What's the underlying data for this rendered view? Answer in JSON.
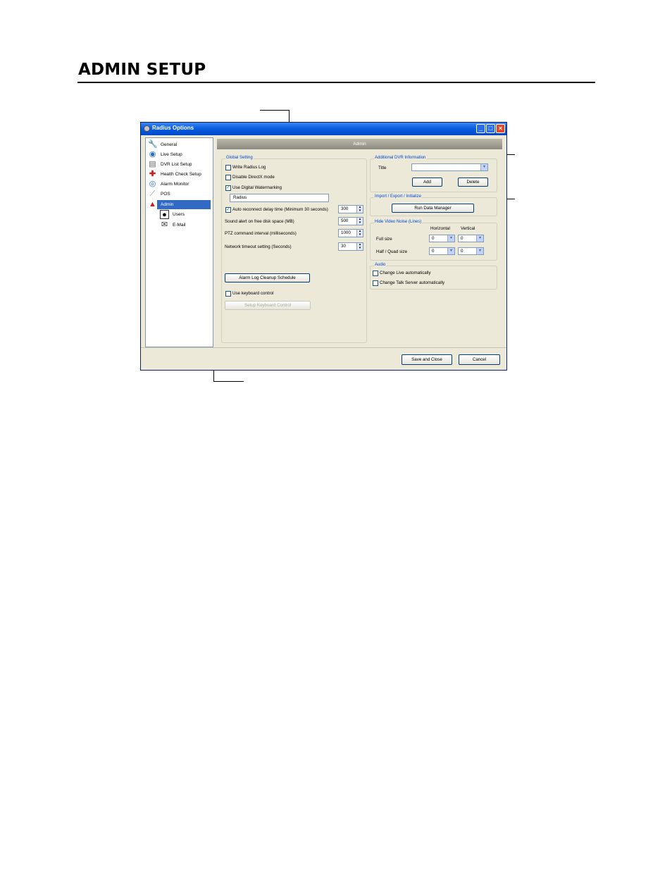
{
  "document": {
    "title": "ADMIN SETUP"
  },
  "window": {
    "title": "Radius Options"
  },
  "nav": {
    "items": [
      {
        "label": "General",
        "icon": "wrench-icon"
      },
      {
        "label": "Live Setup",
        "icon": "globe-monitor-icon"
      },
      {
        "label": "DVR List Setup",
        "icon": "dvr-list-icon"
      },
      {
        "label": "Health Check Setup",
        "icon": "red-cross-icon"
      },
      {
        "label": "Alarm Monitor",
        "icon": "alarm-bell-icon"
      },
      {
        "label": "POS",
        "icon": "pos-icon"
      },
      {
        "label": "Admin",
        "icon": "admin-user-icon",
        "selected": true
      },
      {
        "label": "Users",
        "icon": "user-icon"
      },
      {
        "label": "E-Mail",
        "icon": "envelope-icon"
      }
    ]
  },
  "content": {
    "header": "Admin"
  },
  "global": {
    "title": "Global Setting",
    "write_log": {
      "label": "Write Radius Log",
      "checked": false
    },
    "directx": {
      "label": "Disable DirectX mode",
      "checked": false
    },
    "watermark": {
      "label": "Use Digital Watermarking",
      "checked": true
    },
    "watermark_text": "Radius",
    "reconnect": {
      "label": "Auto reconnect delay time (Minimum 30 seconds)",
      "checked": true,
      "value": "300"
    },
    "sound_alert": {
      "label": "Sound alert on free disk space (MB)",
      "value": "500"
    },
    "ptz": {
      "label": "PTZ command interval (milliseconds)",
      "value": "1000"
    },
    "network": {
      "label": "Network timeout setting (Seconds)",
      "value": "30"
    },
    "alarm_log_button": "Alarm Log Cleanup Schedule",
    "keyboard": {
      "label": "Use keyboard control",
      "checked": false
    },
    "keyboard_button": "Setup Keyboard Control"
  },
  "dvr_info": {
    "title": "Additional DVR Information",
    "title_label": "Title",
    "title_value": "",
    "add": "Add",
    "delete": "Delete"
  },
  "import_export": {
    "title": "Import / Export / Initialize",
    "button": "Run Data Manager"
  },
  "noise": {
    "title": "Hide Video Noise (Lines)",
    "col_h": "Horizontal",
    "col_v": "Vertical",
    "full": {
      "label": "Full size",
      "h": "0",
      "v": "0"
    },
    "half": {
      "label": "Half / Quad size",
      "h": "0",
      "v": "0"
    }
  },
  "audio": {
    "title": "Audio",
    "live": {
      "label": "Change Live automatically",
      "checked": false
    },
    "talk": {
      "label": "Change Talk Server automatically",
      "checked": false
    }
  },
  "footer": {
    "save": "Save and Close",
    "cancel": "Cancel"
  },
  "colors": {
    "accent": "#316ac5",
    "titlebar": "#0a5ee0",
    "group_title": "#0046d5",
    "dialog_bg": "#ece9d8"
  }
}
